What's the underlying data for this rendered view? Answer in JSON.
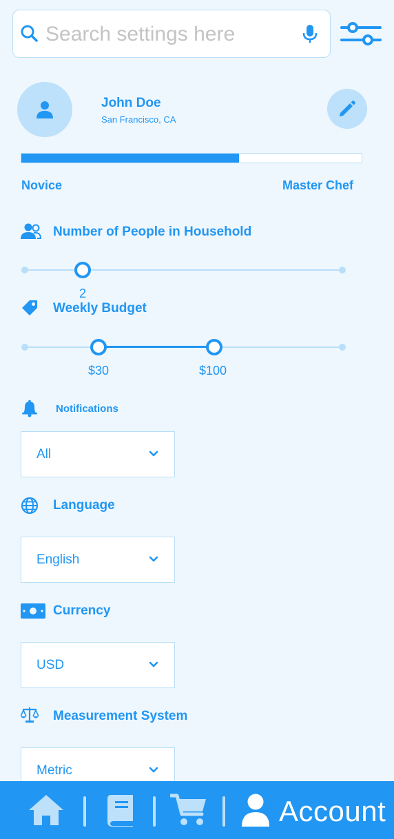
{
  "search": {
    "placeholder": "Search settings here",
    "value": ""
  },
  "profile": {
    "name": "John Doe",
    "location": "San Francisco, CA"
  },
  "skill": {
    "progress": 0.64,
    "min_label": "Novice",
    "max_label": "Master Chef"
  },
  "household": {
    "title": "Number of People in Household",
    "value": "2"
  },
  "budget": {
    "title": "Weekly Budget",
    "low": "$30",
    "high": "$100"
  },
  "notifications": {
    "title": "Notifications",
    "selected": "All"
  },
  "language": {
    "title": "Language",
    "selected": "English"
  },
  "currency": {
    "title": "Currency",
    "selected": "USD"
  },
  "measurement": {
    "title": "Measurement System",
    "selected": "Metric"
  },
  "nav": {
    "items": [
      {
        "icon": "home-icon"
      },
      {
        "icon": "book-icon"
      },
      {
        "icon": "cart-icon"
      },
      {
        "icon": "person-icon",
        "label": "Account"
      }
    ]
  },
  "colors": {
    "accent": "#2196f3",
    "accent_light": "#bde0fb",
    "background": "#eef7fd"
  }
}
